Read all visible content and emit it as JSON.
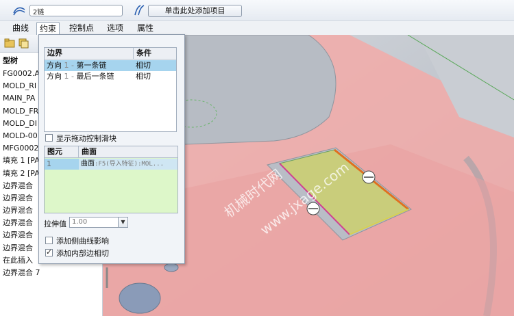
{
  "toolbar": {
    "chain_value": "2链",
    "add_item_label": "单击此处添加项目"
  },
  "tabs": [
    {
      "label": "曲线"
    },
    {
      "label": "约束"
    },
    {
      "label": "控制点"
    },
    {
      "label": "选项"
    },
    {
      "label": "属性"
    }
  ],
  "tree": {
    "header": "型树",
    "items": [
      "FG0002.AS",
      "MOLD_RI",
      "MAIN_PA",
      "MOLD_FR",
      "MOLD_DI",
      "MOLD-00",
      "MFG0002",
      "填充 1 [PA",
      "填充 2 [PA",
      "边界混合",
      "边界混合",
      "边界混合",
      "边界混合",
      "边界混合",
      "边界混合",
      "在此插入",
      "边界混合 7"
    ]
  },
  "panel": {
    "table1": {
      "headers": [
        "边界",
        "条件"
      ],
      "rows": [
        {
          "direction": "方向",
          "num": "1",
          "sep": "-",
          "chain": "第一条链",
          "condition": "相切"
        },
        {
          "direction": "方向",
          "num": "1",
          "sep": "-",
          "chain": "最后一条链",
          "condition": "相切"
        }
      ]
    },
    "show_drag_slider_label": "显示拖动控制滑块",
    "table2": {
      "headers": [
        "图元",
        "曲面"
      ],
      "rows": [
        {
          "id": "1",
          "surface": "曲面",
          "detail": ":F5(导入特征):MOL..."
        }
      ]
    },
    "stretch_label": "拉伸值",
    "stretch_value": "1.00",
    "add_side_curve_label": "添加侧曲线影响",
    "add_inner_edge_label": "添加内部边相切"
  },
  "watermark": {
    "line1": "机械时代网",
    "line2": "www.jxage.com"
  },
  "colors": {
    "selection": "#a6d4ee",
    "surface_list_bg": "#ddf7c9",
    "part_pink": "#f0a8a8",
    "patch_yellow": "#c8cc78",
    "edge_orange": "#e07020"
  }
}
